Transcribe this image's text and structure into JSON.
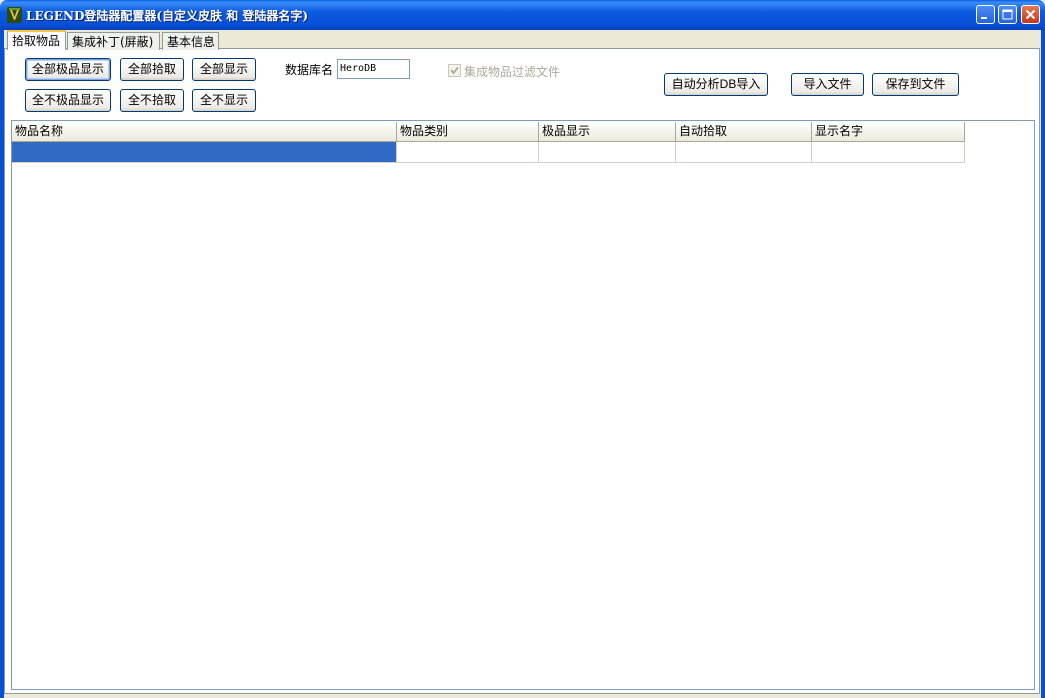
{
  "window": {
    "title": "LEGEND登陆器配置器(自定义皮肤 和 登陆器名字)",
    "accent_color": "#0750d6"
  },
  "tabs": [
    {
      "label": "拾取物品",
      "active": true
    },
    {
      "label": "集成补丁(屏蔽)",
      "active": false
    },
    {
      "label": "基本信息",
      "active": false
    }
  ],
  "toolbar": {
    "all_best_show": "全部极品显示",
    "all_pickup": "全部拾取",
    "all_show": "全部显示",
    "none_best_show": "全不极品显示",
    "none_pickup": "全不拾取",
    "none_show": "全不显示",
    "db_label": "数据库名",
    "db_value": "HeroDB",
    "filter_checkbox_label": "集成物品过滤文件",
    "auto_analyze_import": "自动分析DB导入",
    "import_file": "导入文件",
    "save_to_file": "保存到文件"
  },
  "grid": {
    "columns": [
      "物品名称",
      "物品类别",
      "极品显示",
      "自动拾取",
      "显示名字"
    ],
    "rows": [
      [
        "",
        "",
        "",
        "",
        ""
      ]
    ],
    "selected_color": "#316ac5"
  }
}
